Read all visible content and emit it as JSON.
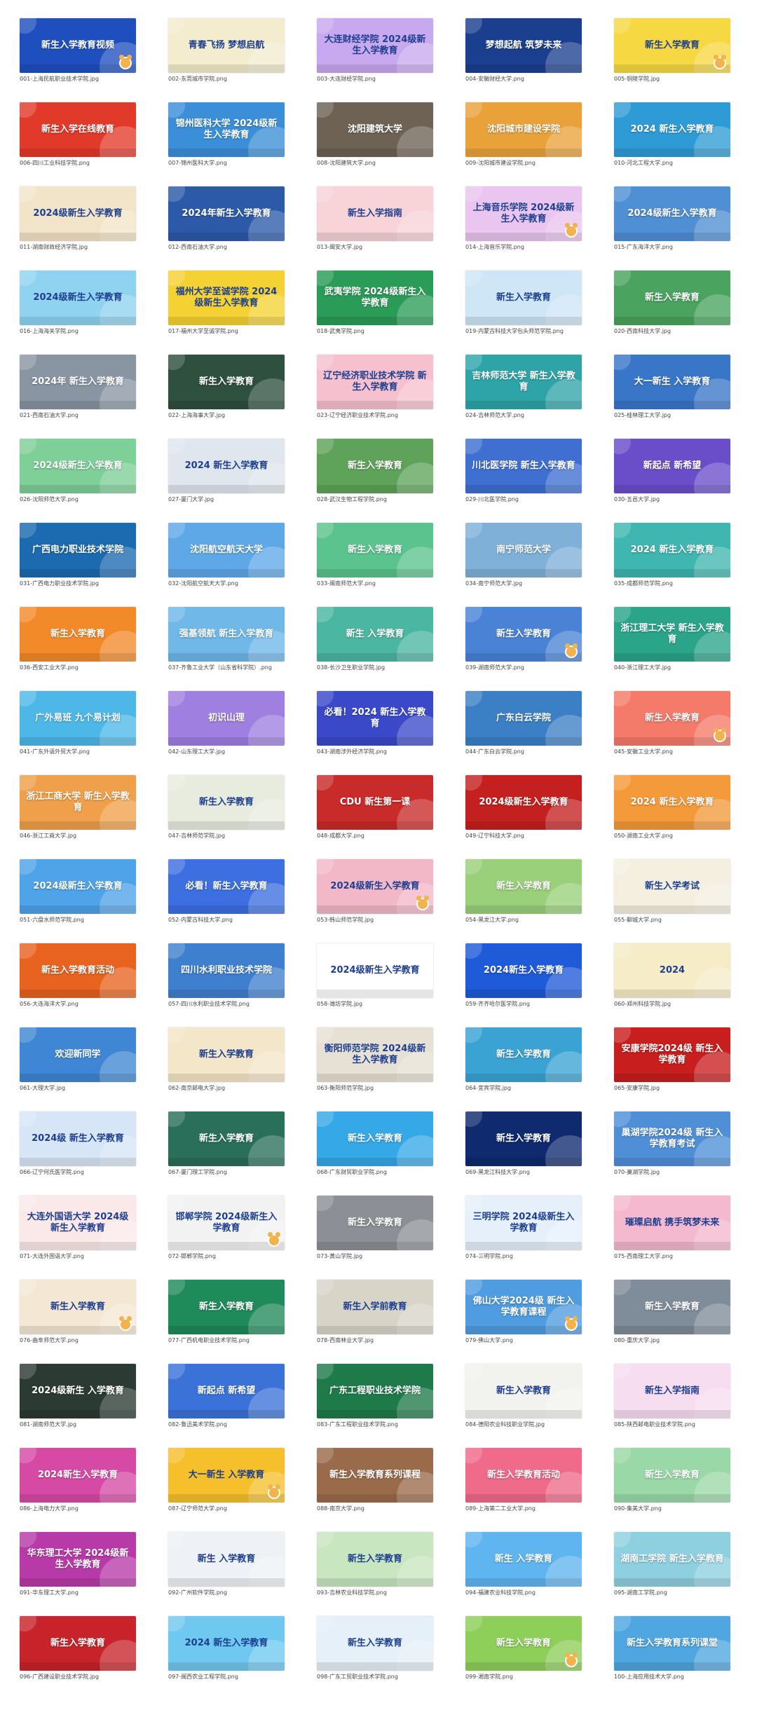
{
  "items": [
    {
      "caption": "001-上海民航职业技术学院.jpg",
      "title": "新生入学教育视频",
      "bg": "#1f4fbf",
      "mascot": true
    },
    {
      "caption": "002-东莞城市学院.png",
      "title": "青春飞扬 梦想启航",
      "bg": "#f3eccf",
      "light": true
    },
    {
      "caption": "003-大连财经学院.png",
      "title": "大连财经学院 2024级新生入学教育",
      "bg": "#c8a8ef",
      "light": true
    },
    {
      "caption": "004-安徽财经大学.png",
      "title": "梦想起航 筑梦未来",
      "bg": "#1b3f8f"
    },
    {
      "caption": "005-铜陵学院.jpg",
      "title": "新生入学教育",
      "bg": "#f6d842",
      "light": true,
      "mascot": true
    },
    {
      "caption": "006-四川工业科技学院.png",
      "title": "新生入学在线教育",
      "bg": "#e23a2a"
    },
    {
      "caption": "007-锦州医科大学.png",
      "title": "锦州医科大学 2024级新生入学教育",
      "bg": "#3b8fd8"
    },
    {
      "caption": "008-沈阳建筑大学.png",
      "title": "沈阳建筑大学",
      "bg": "#6d6254"
    },
    {
      "caption": "009-沈阳城市建设学院.png",
      "title": "沈阳城市建设学院",
      "bg": "#e9a23a"
    },
    {
      "caption": "010-河北工程大学.png",
      "title": "2024 新生入学教育",
      "bg": "#2f9bd6"
    },
    {
      "caption": "011-湖南财政经济学院.jpg",
      "title": "2024级新生入学教育",
      "bg": "#f2e4c8",
      "light": true
    },
    {
      "caption": "012-西南石油大学.png",
      "title": "2024年新生入学教育",
      "bg": "#2c5aa8"
    },
    {
      "caption": "013-闽安大学.jpg",
      "title": "新生入学指南",
      "bg": "#f8d3d8",
      "light": true
    },
    {
      "caption": "014-上海音乐学院.png",
      "title": "上海音乐学院 2024级新生入学教育",
      "bg": "#e9c5ef",
      "light": true,
      "mascot": true
    },
    {
      "caption": "015-广东海洋大学.png",
      "title": "2024级新生入学教育",
      "bg": "#4f8fd4"
    },
    {
      "caption": "016-上海海关学院.png",
      "title": "2024级新生入学教育",
      "bg": "#8fd3f0",
      "light": true
    },
    {
      "caption": "017-福州大学至诚学院.png",
      "title": "福州大学至诚学院 2024级新生入学教育",
      "bg": "#f4d233",
      "light": true
    },
    {
      "caption": "018-武夷学院.png",
      "title": "武夷学院 2024级新生入学教育",
      "bg": "#2b9c58"
    },
    {
      "caption": "019-内蒙古科技大学包头师范学院.png",
      "title": "新生入学教育",
      "bg": "#cfe6f7",
      "light": true
    },
    {
      "caption": "020-西南科技大学.jpg",
      "title": "新生入学教育",
      "bg": "#4aa35e"
    },
    {
      "caption": "021-西南石油大学.png",
      "title": "2024年 新生入学教育",
      "bg": "#8a95a3"
    },
    {
      "caption": "022-上海海事大学.jpg",
      "title": "新生入学教育",
      "bg": "#2f4f3f"
    },
    {
      "caption": "023-辽宁经济职业技术学院.png",
      "title": "辽宁经济职业技术学院 新生入学教育",
      "bg": "#f6c0cf",
      "light": true
    },
    {
      "caption": "024-吉林师范大学.png",
      "title": "吉林师范大学 新生入学教育",
      "bg": "#2fa4a8"
    },
    {
      "caption": "025-桂林理工大学.jpg",
      "title": "大一新生 入学教育",
      "bg": "#3a76c8"
    },
    {
      "caption": "026-沈阳师范大学.png",
      "title": "2024级新生入学教育",
      "bg": "#7ecf98"
    },
    {
      "caption": "027-厦门大学.jpg",
      "title": "2024 新生入学教育",
      "bg": "#dfe6ee",
      "light": true
    },
    {
      "caption": "028-武汉生物工程学院.png",
      "title": "新生入学教育",
      "bg": "#5fa35a"
    },
    {
      "caption": "029-川北医学院.png",
      "title": "川北医学院 新生入学教育",
      "bg": "#3e6fd1"
    },
    {
      "caption": "030-五邑大学.jpg",
      "title": "新起点 新希望",
      "bg": "#6a4ec9"
    },
    {
      "caption": "031-广西电力职业技术学院.jpg",
      "title": "广西电力职业技术学院",
      "bg": "#1c6ab0"
    },
    {
      "caption": "032-沈阳航空航天大学.png",
      "title": "沈阳航空航天大学",
      "bg": "#5fa8e8"
    },
    {
      "caption": "033-闽南师范大学.png",
      "title": "新生入学教育",
      "bg": "#5bc38d"
    },
    {
      "caption": "034-南宁师范大学.jpg",
      "title": "南宁师范大学",
      "bg": "#7fb0d8"
    },
    {
      "caption": "035-成都师范学院.png",
      "title": "2024 新生入学教育",
      "bg": "#3fb6b0"
    },
    {
      "caption": "036-西安工业大学.png",
      "title": "新生入学教育",
      "bg": "#f38a2a"
    },
    {
      "caption": "037-齐鲁工业大学（山东省科学院）.png",
      "title": "强基领航 新生入学教育",
      "bg": "#6fb8e8"
    },
    {
      "caption": "038-长沙卫生职业学院.jpg",
      "title": "新生 入学教育",
      "bg": "#4bb7a2"
    },
    {
      "caption": "039-湖南师范大学.png",
      "title": "新生入学教育",
      "bg": "#4a83d6",
      "mascot": true
    },
    {
      "caption": "040-浙江理工大学.jpg",
      "title": "浙江理工大学 新生入学教育",
      "bg": "#2aa58a"
    },
    {
      "caption": "041-广东外语外贸大学.png",
      "title": "广外易班 九个易计划",
      "bg": "#4db8e8"
    },
    {
      "caption": "042-山东理工大学.jpg",
      "title": "初识山理",
      "bg": "#9f7fe0"
    },
    {
      "caption": "043-湖南涉外经济学院.png",
      "title": "必看！2024 新生入学教育",
      "bg": "#3a49c8"
    },
    {
      "caption": "044-广东白云学院.png",
      "title": "广东白云学院",
      "bg": "#3b7fc4"
    },
    {
      "caption": "045-安徽工业大学.png",
      "title": "新生入学教育",
      "bg": "#f47a6a",
      "mascot": true
    },
    {
      "caption": "046-浙江工商大学.jpg",
      "title": "浙江工商大学 新生入学教育",
      "bg": "#f0a04a"
    },
    {
      "caption": "047-吉林师范学院.jpg",
      "title": "新生入学教育",
      "bg": "#e8ecdf",
      "light": true
    },
    {
      "caption": "048-成都大学.png",
      "title": "CDU 新生第一课",
      "bg": "#c92a2a"
    },
    {
      "caption": "049-辽宁科技大学.png",
      "title": "2024级新生入学教育",
      "bg": "#c42020"
    },
    {
      "caption": "050-湖南工业大学.png",
      "title": "2024 新生入学教育",
      "bg": "#f49a3a"
    },
    {
      "caption": "051-六盘水师范学院.png",
      "title": "2024级新生入学教育",
      "bg": "#4fa3e8"
    },
    {
      "caption": "052-内蒙古科技大学.png",
      "title": "必看！新生入学教育",
      "bg": "#3d6fe0"
    },
    {
      "caption": "053-韩山师范学院.jpg",
      "title": "2024级新生入学教育",
      "bg": "#f2b8c8",
      "light": true,
      "mascot": true
    },
    {
      "caption": "054-黑龙江大学.png",
      "title": "新生入学教育",
      "bg": "#9ad07a"
    },
    {
      "caption": "055-聊城大学.png",
      "title": "新生入学考试",
      "bg": "#f5efe0",
      "light": true
    },
    {
      "caption": "056-大连海洋大学.png",
      "title": "新生入学教育活动",
      "bg": "#e8631f"
    },
    {
      "caption": "057-四川水利职业技术学院.png",
      "title": "四川水利职业技术学院",
      "bg": "#3f7fcf"
    },
    {
      "caption": "058-潍坊学院.jpg",
      "title": "2024级新生入学教育",
      "bg": "#ffffff",
      "light": true
    },
    {
      "caption": "059-齐齐哈尔医学院.png",
      "title": "2024新生入学教育",
      "bg": "#1f5ad8"
    },
    {
      "caption": "060-郑州科技学院.jpg",
      "title": "2024",
      "bg": "#f6ecc8",
      "light": true
    },
    {
      "caption": "061-大理大学.jpg",
      "title": "欢迎新同学",
      "bg": "#3f87d4"
    },
    {
      "caption": "062-南京邮电大学.jpg",
      "title": "新生入学教育",
      "bg": "#f4e6c8",
      "light": true
    },
    {
      "caption": "063-衡阳师范学院.jpg",
      "title": "衡阳师范学院 2024级新生入学教育",
      "bg": "#e7e0d4",
      "light": true
    },
    {
      "caption": "064-宜宾学院.jpg",
      "title": "新生入学教育",
      "bg": "#3aa3d4"
    },
    {
      "caption": "065-安康学院.jpg",
      "title": "安康学院2024级 新生入学教育",
      "bg": "#c81e1e"
    },
    {
      "caption": "066-辽宁何氏医学院.png",
      "title": "2024级 新生入学教育",
      "bg": "#d6e6f6",
      "light": true
    },
    {
      "caption": "067-厦门理工学院.png",
      "title": "新生入学教育",
      "bg": "#2a6f5a"
    },
    {
      "caption": "068-广东财贸职业学院.png",
      "title": "新生入学教育",
      "bg": "#35a8e8"
    },
    {
      "caption": "069-黑龙江科技大学.png",
      "title": "新生入学教育",
      "bg": "#0f2a6f"
    },
    {
      "caption": "070-巢湖学院.jpg",
      "title": "巢湖学院2024级 新生入学教育考试",
      "bg": "#4f8fd8"
    },
    {
      "caption": "071-大连外国语大学.png",
      "title": "大连外国语大学 2024级新生入学教育",
      "bg": "#fbe9e9",
      "light": true
    },
    {
      "caption": "072-邯郸学院.png",
      "title": "邯郸学院 2024级新生入学教育",
      "bg": "#f2f2f2",
      "light": true,
      "mascot": true
    },
    {
      "caption": "073-黄山学院.jpg",
      "title": "新生入学教育",
      "bg": "#8c9096"
    },
    {
      "caption": "074-三明学院.png",
      "title": "三明学院 2024级新生入学教育",
      "bg": "#e6f0fb",
      "light": true
    },
    {
      "caption": "075-西南理工大学.png",
      "title": "璀璨启航 携手筑梦未来",
      "bg": "#f4b8cf",
      "light": true
    },
    {
      "caption": "076-曲阜师范大学.png",
      "title": "新生入学教育",
      "bg": "#f4e8d4",
      "light": true,
      "mascot": true
    },
    {
      "caption": "077-广西机电职业技术学院.png",
      "title": "新生入学教育",
      "bg": "#1f8a5a"
    },
    {
      "caption": "078-西南林业大学.jpg",
      "title": "新生入学前教育",
      "bg": "#d8d4c8",
      "light": true
    },
    {
      "caption": "079-佛山大学.png",
      "title": "佛山大学2024级 新生入学教育课程",
      "bg": "#4f9ce0",
      "mascot": true
    },
    {
      "caption": "080-重庆大学.jpg",
      "title": "新生入学教育",
      "bg": "#7f8c99"
    },
    {
      "caption": "081-湖南师范大学.jpg",
      "title": "2024级新生 入学教育",
      "bg": "#2c3a34"
    },
    {
      "caption": "082-鲁迅美术学院.png",
      "title": "新起点 新希望",
      "bg": "#3a72d8"
    },
    {
      "caption": "083-广东工程职业技术学院.png",
      "title": "广东工程职业技术学院",
      "bg": "#1f7a4a"
    },
    {
      "caption": "084-德阳农业科技职业学院.jpg",
      "title": "新生入学教育",
      "bg": "#f2f2ee",
      "light": true
    },
    {
      "caption": "085-陕西邮电职业技术学院.png",
      "title": "新生入学指南",
      "bg": "#f6ddf0",
      "light": true
    },
    {
      "caption": "086-上海电力大学.png",
      "title": "2024新生入学教育",
      "bg": "#d64aa6"
    },
    {
      "caption": "087-辽宁师范大学.png",
      "title": "大一新生 入学教育",
      "bg": "#f6c02c",
      "light": true,
      "mascot": true
    },
    {
      "caption": "088-南京大学.png",
      "title": "新生入学教育系列课程",
      "bg": "#9a6b4a"
    },
    {
      "caption": "089-上海第二工业大学.png",
      "title": "新生入学教育活动",
      "bg": "#f06a8a"
    },
    {
      "caption": "090-集美大学.png",
      "title": "新生入学教育",
      "bg": "#9bd8a8"
    },
    {
      "caption": "091-华东理工大学.png",
      "title": "华东理工大学 2024级新生入学教育",
      "bg": "#b83aa8"
    },
    {
      "caption": "092-广州软件学院.png",
      "title": "新生 入学教育",
      "bg": "#eef2f6",
      "light": true
    },
    {
      "caption": "093-吉林农业科技学院.png",
      "title": "新生入学教育",
      "bg": "#c8e6c0",
      "light": true
    },
    {
      "caption": "094-福建农业科技学院.png",
      "title": "新生 入学教育",
      "bg": "#5fb5f0"
    },
    {
      "caption": "095-湖南工学院.png",
      "title": "湖南工学院 新生入学教育",
      "bg": "#8fd0e0"
    },
    {
      "caption": "096-广西建设职业技术学院.jpg",
      "title": "新生入学教育",
      "bg": "#c8232a"
    },
    {
      "caption": "097-闽西农业工程学院.png",
      "title": "2024 新生入学教育",
      "bg": "#6fc8f0",
      "light": true
    },
    {
      "caption": "098-广东工贸职业技术学院.png",
      "title": "新生入学教育",
      "bg": "#e6f0f8",
      "light": true
    },
    {
      "caption": "099-湘南学院.png",
      "title": "新生入学教育",
      "bg": "#8ecf5a",
      "mascot": true
    },
    {
      "caption": "100-上海应用技术大学.png",
      "title": "新生入学教育系列课堂",
      "bg": "#4fa6e0"
    }
  ]
}
